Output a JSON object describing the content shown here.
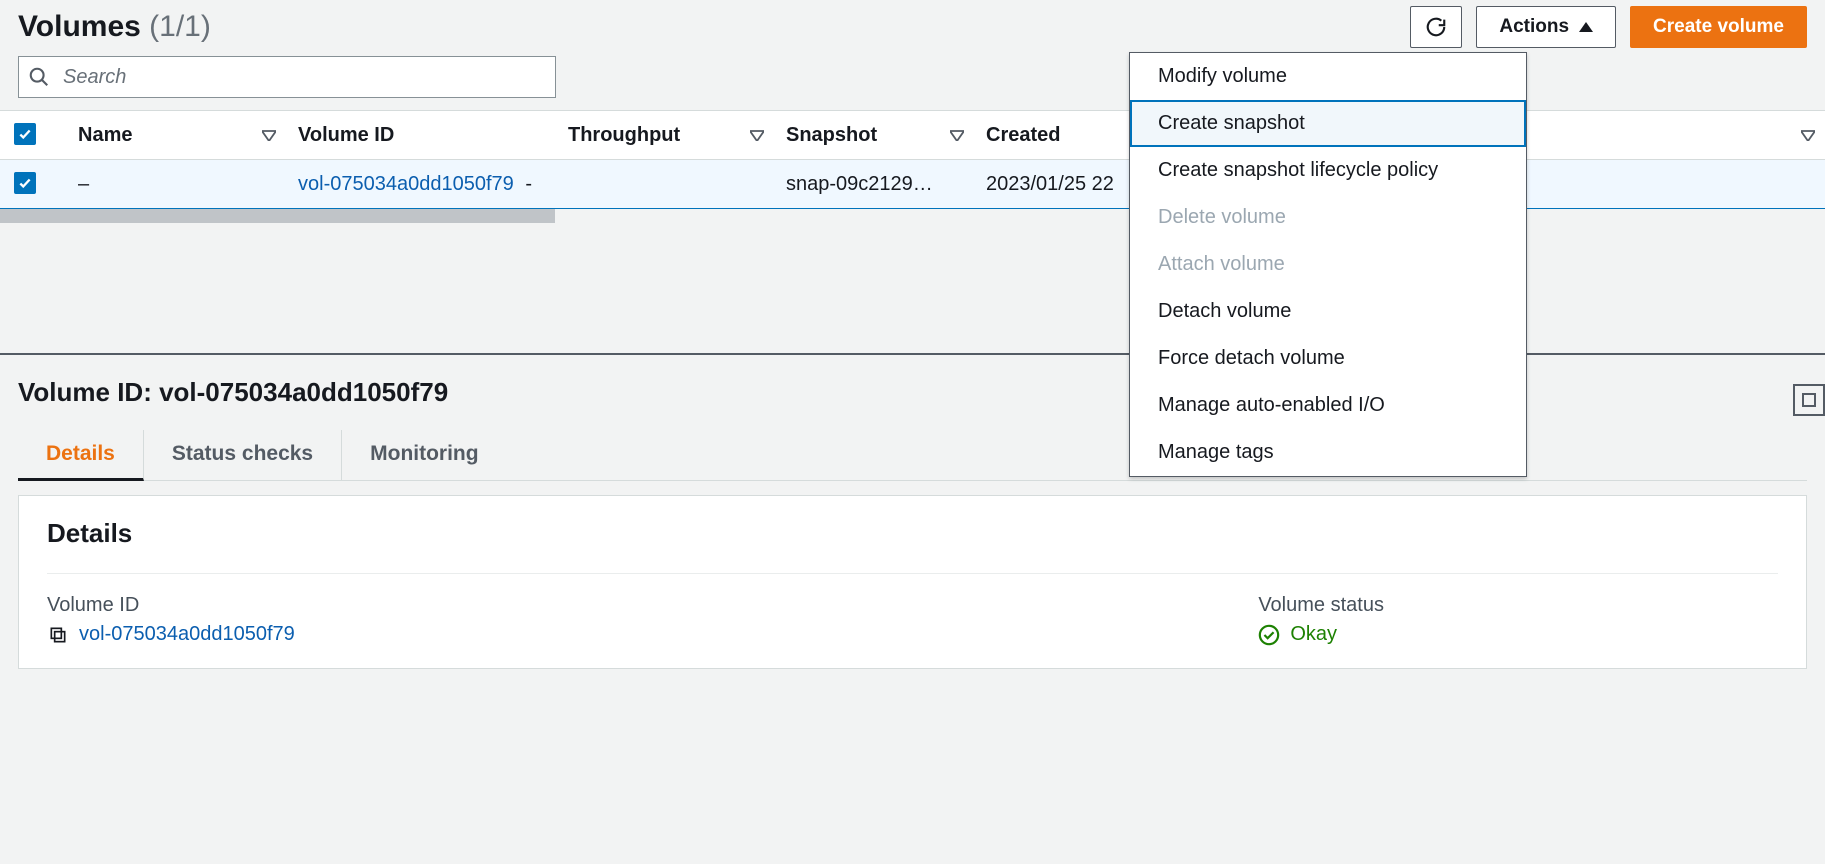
{
  "header": {
    "title": "Volumes",
    "count": "(1/1)",
    "actions_label": "Actions",
    "create_label": "Create volume"
  },
  "search": {
    "placeholder": "Search"
  },
  "table": {
    "columns": {
      "name": "Name",
      "volume_id": "Volume ID",
      "throughput": "Throughput",
      "snapshot": "Snapshot",
      "created": "Created"
    },
    "row": {
      "name": "–",
      "volume_id": "vol-075034a0dd1050f79",
      "throughput": "-",
      "snapshot": "snap-09c2129…",
      "created": "2023/01/25 22"
    }
  },
  "actions_menu": {
    "items": [
      {
        "label": "Modify volume",
        "disabled": false,
        "hovered": false
      },
      {
        "label": "Create snapshot",
        "disabled": false,
        "hovered": true
      },
      {
        "label": "Create snapshot lifecycle policy",
        "disabled": false,
        "hovered": false
      },
      {
        "label": "Delete volume",
        "disabled": true,
        "hovered": false
      },
      {
        "label": "Attach volume",
        "disabled": true,
        "hovered": false
      },
      {
        "label": "Detach volume",
        "disabled": false,
        "hovered": false
      },
      {
        "label": "Force detach volume",
        "disabled": false,
        "hovered": false
      },
      {
        "label": "Manage auto-enabled I/O",
        "disabled": false,
        "hovered": false
      },
      {
        "label": "Manage tags",
        "disabled": false,
        "hovered": false
      }
    ]
  },
  "detail": {
    "title": "Volume ID: vol-075034a0dd1050f79",
    "tabs": {
      "details": "Details",
      "status": "Status checks",
      "monitoring": "Monitoring"
    },
    "card_title": "Details",
    "fields": {
      "volume_id": {
        "label": "Volume ID",
        "value": "vol-075034a0dd1050f79"
      },
      "volume_status": {
        "label": "Volume status",
        "value": "Okay"
      }
    }
  }
}
